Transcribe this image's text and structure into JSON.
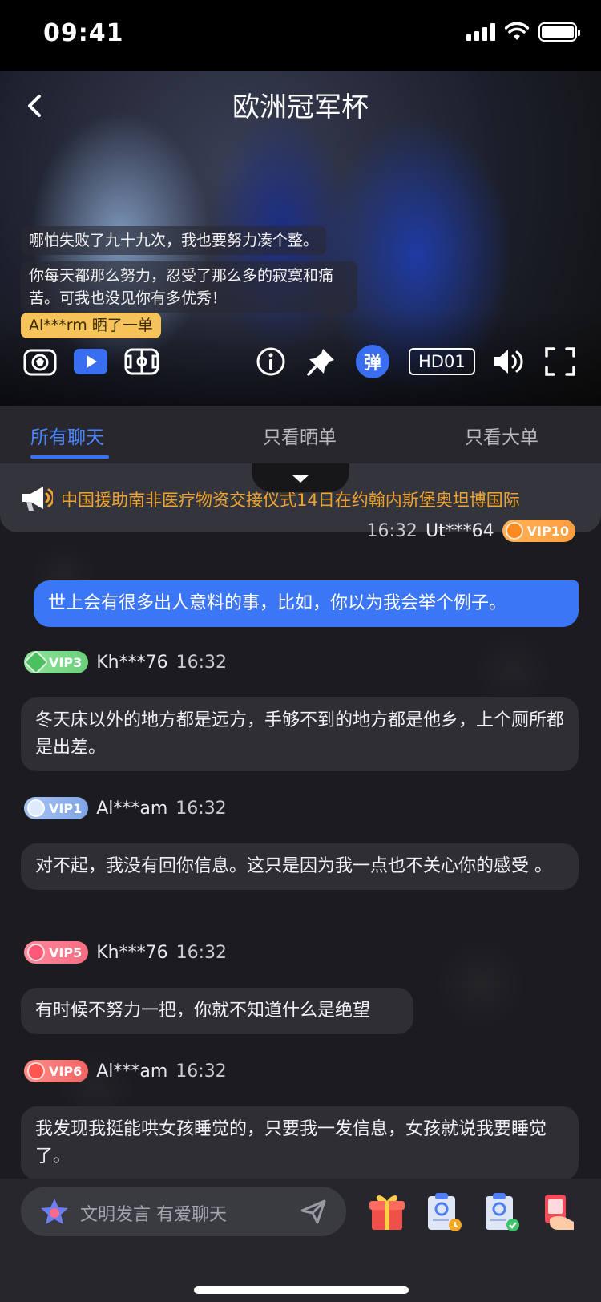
{
  "status_bar": {
    "time": "09:41"
  },
  "video": {
    "title": "欧洲冠军杯",
    "danmu": [
      "哪怕失败了九十九次，我也要努力凑个整。",
      "你每天都那么努力，忍受了那么多的寂寞和痛苦。可我也没见你有多优秀！"
    ],
    "share_text": "Al***rm 晒了一单",
    "controls": {
      "quality": "HD01",
      "danmu_toggle": "弹"
    }
  },
  "tabs": [
    {
      "label": "所有聊天",
      "active": true
    },
    {
      "label": "只看晒单",
      "active": false
    },
    {
      "label": "只看大单",
      "active": false
    }
  ],
  "notice": {
    "text": "中国援助南非医疗物资交接仪式14日在约翰内斯堡奥坦博国际"
  },
  "messages": [
    {
      "user": "Ut***64",
      "time": "16:32",
      "vip": "VIP10",
      "text": "世上会有很多出人意料的事，比如，你以为我会举个例子。",
      "mine": true
    },
    {
      "user": "Kh***76",
      "time": "16:32",
      "vip": "VIP3",
      "text": "冬天床以外的地方都是远方，手够不到的地方都是他乡，上个厕所都是出差。"
    },
    {
      "user": "Al***am",
      "time": "16:32",
      "vip": "VIP1",
      "text": "对不起，我没有回你信息。这只是因为我一点也不关心你的感受 。"
    },
    {
      "user": "Kh***76",
      "time": "16:32",
      "vip": "VIP5",
      "text": "有时候不努力一把，你就不知道什么是绝望"
    },
    {
      "user": "Al***am",
      "time": "16:32",
      "vip": "VIP6",
      "text": "我发现我挺能哄女孩睡觉的，只要我一发信息，女孩就说我要睡觉了。"
    }
  ],
  "input": {
    "placeholder": "文明发言 有爱聊天"
  },
  "colors": {
    "accent": "#3b76f6",
    "notice": "#f0a32e",
    "share_badge": "#f5c35a"
  }
}
